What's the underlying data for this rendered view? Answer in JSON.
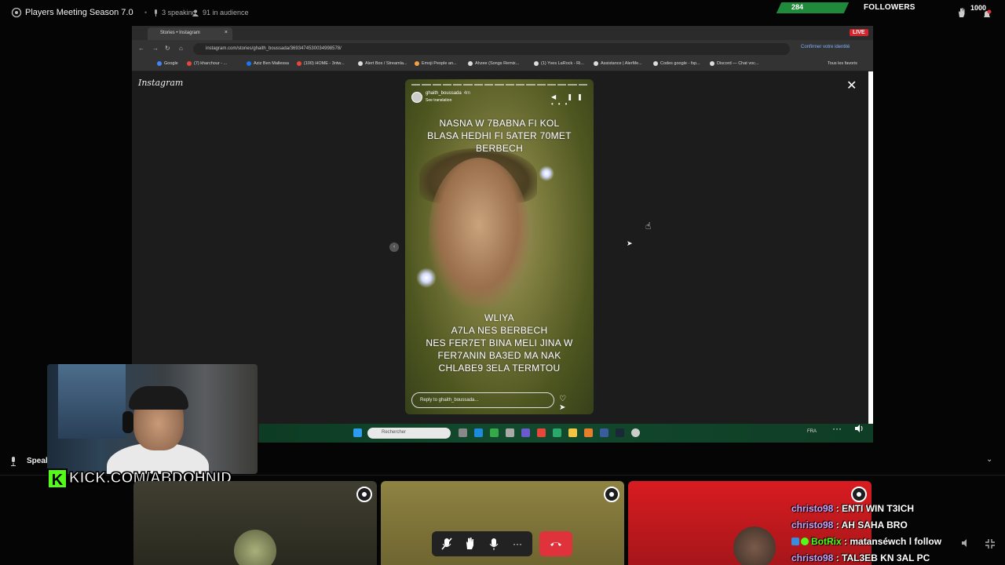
{
  "topbar": {
    "title": "Players Meeting Season 7.0",
    "speaking": "3 speaking",
    "audience": "91 in audience",
    "followers_count": "284",
    "followers_label": "FOLLOWERS",
    "followers_goal": "1000"
  },
  "browser": {
    "tab_title": "Stories • Instagram",
    "tab_close": "×",
    "live": "LIVE",
    "url": "instagram.com/stories/ghaith_boussada/3693474530034998578/",
    "bookmarks": [
      "Google",
      "(7) kharchour - ...",
      "Aziz Ben Mallessa",
      "(100) HOME - 3ntw...",
      "Alert Box / Streamla...",
      "Emoji People an...",
      "Ahzee (Songs Remix...",
      "(1) Yves LaRock - Ri...",
      "Assistance | AlerMe...",
      "Codes google - fsp...",
      "Discord — Chat voc..."
    ],
    "bookmarks_all": "Tous les favoris",
    "verify_text": "Confirmer votre identité",
    "logo": "Instagram",
    "close_glyph": "✕"
  },
  "story": {
    "username": "ghaith_boussada",
    "time": "4m",
    "see_translation": "See translation",
    "top_text": [
      "NASNA W 7BABNA FI KOL",
      "BLASA HEDHI FI 5ATER 70MET",
      "BERBECH"
    ],
    "bottom_text": [
      "WLIYA",
      "A7LA NES BERBECH",
      "NES FER7ET BINA MELI JINA W",
      "FER7ANIN BA3ED MA NAK",
      "CHLABE9 3ELA TERMTOU"
    ],
    "reply_placeholder": "Reply to ghaith_boussada...",
    "controls": "◀ ❚❚ •••",
    "reply_icons": "♡ ➤"
  },
  "taskbar": {
    "search_placeholder": "Rechercher",
    "lang": "FRA",
    "more": "···",
    "volume": "🔊"
  },
  "webcam": {
    "kick_logo": "K",
    "kick_text": "KICK.COM/ABDOHNID"
  },
  "speakers": {
    "label": "Speak",
    "chevron": "⌄"
  },
  "controls": {
    "mute": "🎤",
    "raise_hand": "✋",
    "mic": "🎙",
    "more": "···",
    "end": "✆"
  },
  "chat": [
    {
      "user": "christo98",
      "message": ": ENTI WIN T3ICH"
    },
    {
      "user": "christo98",
      "message": ": AH SAHA BRO"
    },
    {
      "user": "BotRix",
      "message": ": matanséwch l follow",
      "bot": true
    },
    {
      "user": "christo98",
      "message": ": TAL3EB KN 3AL PC"
    }
  ],
  "colors": {
    "followers_bar": "#1f8a3b",
    "kick_green": "#53fc18",
    "end_call": "#e0323a",
    "chat_user": "#c6a6ff",
    "tile_1": "#3b3a2e",
    "tile_2": "#8a7d3e",
    "tile_3": "#d51a1f"
  },
  "icons": {
    "stage": "stage-icon",
    "speaking": "mic-icon",
    "audience": "people-icon",
    "hand": "hand-icon",
    "notification": "bell-icon",
    "volume": "volume-icon",
    "fullscreen": "fullscreen-icon"
  }
}
